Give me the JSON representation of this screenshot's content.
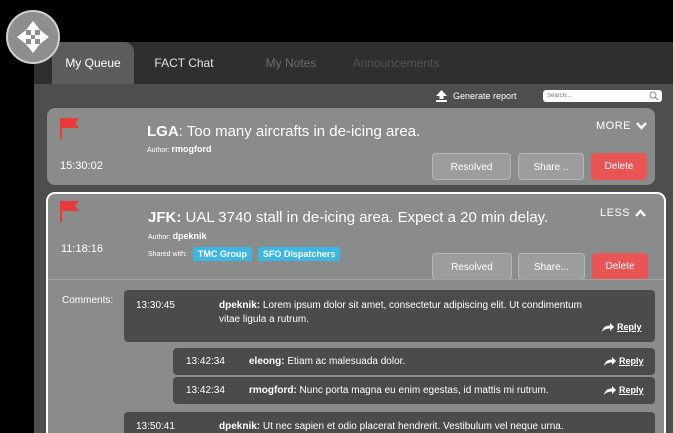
{
  "tabs": [
    {
      "label": "My Queue"
    },
    {
      "label": "FACT Chat"
    },
    {
      "label": "My Notes"
    },
    {
      "label": "Announcements"
    }
  ],
  "toolbar": {
    "report_label": "Generate report",
    "search_placeholder": "Search..."
  },
  "alerts": [
    {
      "code": "LGA",
      "message": ": Too many aircrafts in de-icing area.",
      "time": "15:30:02",
      "author_label": "Author:",
      "author": "rmogford",
      "toggle_label": "MORE",
      "resolved_label": "Resolved",
      "share_label": "Share...",
      "delete_label": "Delete"
    },
    {
      "code": "JFK:",
      "message": " UAL 3740 stall in de-icing area. Expect a 20 min delay.",
      "time": "11:18:16",
      "author_label": "Author:",
      "author": "dpeknik",
      "shared_label": "Shared with:",
      "shared_with": [
        "TMC Group",
        "SFO Dispatchers"
      ],
      "toggle_label": "LESS",
      "resolved_label": "Resolved",
      "share_label": "Share...",
      "delete_label": "Delete",
      "comments_label": "Comments:",
      "comments": [
        {
          "time": "13:30:45",
          "author": "dpeknik:",
          "text_line1": " Lorem ipsum dolor sit amet, consectetur adipiscing elit. Ut condimentum",
          "text_line2": "vitae ligula a rutrum.",
          "reply_label": "Reply"
        },
        {
          "time": "13:42:34",
          "author": "eleong:",
          "text_line1": " Etiam ac malesuada dolor.",
          "reply_label": "Reply"
        },
        {
          "time": "13:42:34",
          "author": "rmogford:",
          "text_line1": " Nunc porta magna eu enim egestas, id mattis mi rutrum.",
          "reply_label": "Reply"
        },
        {
          "time": "13:50:41",
          "author": "dpeknik:",
          "text_line1": " Ut nec sapien et odio placerat hendrerit. Vestibulum vel neque urna."
        }
      ]
    }
  ],
  "colors": {
    "flag": "#e93a3a",
    "delete": "#e95454",
    "tag": "#3cb6e3"
  }
}
